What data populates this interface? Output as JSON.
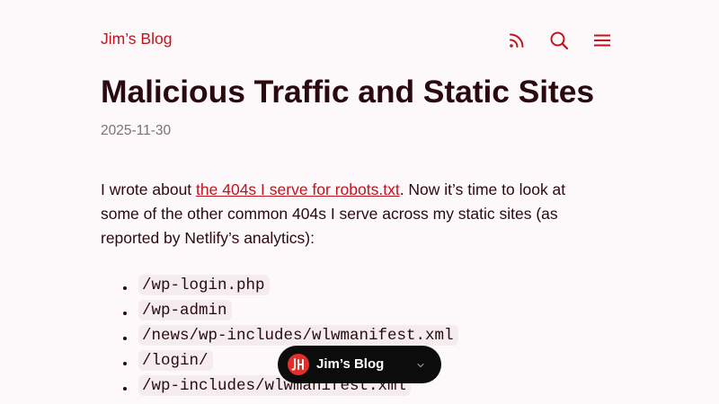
{
  "header": {
    "site_title": "Jim’s Blog",
    "icons": [
      "rss-icon",
      "search-icon",
      "menu-icon"
    ]
  },
  "post": {
    "title": "Malicious Traffic and Static Sites",
    "date": "2025-11-30",
    "intro_before_link": "I wrote about ",
    "intro_link": "the 404s I serve for robots.txt",
    "intro_after_link": ". Now it’s time to look at some of the other common 404s I serve across my static sites (as reported by Netlify’s analytics):",
    "paths": [
      "/wp-login.php",
      "/wp-admin",
      "/news/wp-includes/wlwmanifest.xml",
      "/login/",
      "/wp-includes/wlwmanifest.xml"
    ]
  },
  "floating_pill": {
    "label": "Jim’s Blog",
    "logo_icon": "site-logo-icon",
    "chevron_icon": "chevron-down-icon"
  },
  "colors": {
    "accent": "#c0141e",
    "text": "#2a0a0f",
    "muted": "#7d7173",
    "background": "#fdf9fa",
    "code_background": "#f4ecee",
    "pill_background": "#0c0c0c",
    "logo_red": "#e0302a"
  }
}
